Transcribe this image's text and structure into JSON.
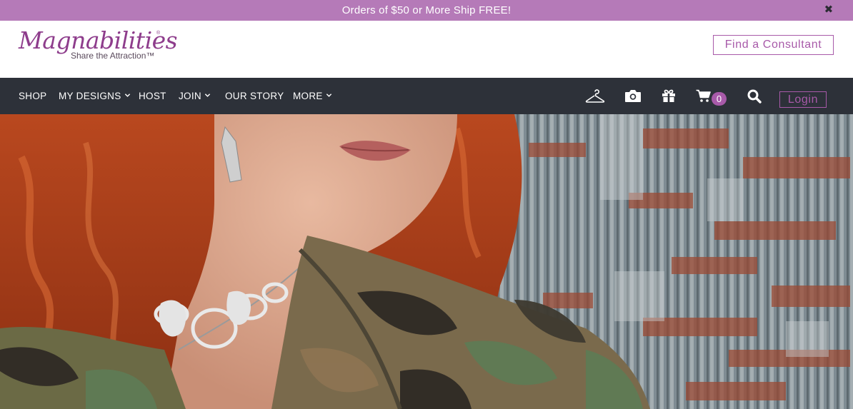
{
  "promo": {
    "text": "Orders of $50 or More Ship FREE!",
    "close_icon": "close-icon"
  },
  "header": {
    "logo_text": "Magnabilities",
    "logo_registered": "®",
    "logo_tagline": "Share the Attraction™",
    "consultant_button": "Find a Consultant"
  },
  "nav": {
    "items": [
      {
        "label": "SHOP",
        "dropdown": false
      },
      {
        "label": "MY DESIGNS",
        "dropdown": true
      },
      {
        "label": "HOST",
        "dropdown": false
      },
      {
        "label": "JOIN",
        "dropdown": true
      },
      {
        "label": "OUR STORY",
        "dropdown": false
      },
      {
        "label": "MORE",
        "dropdown": true
      }
    ],
    "icons": [
      "hanger-icon",
      "camera-icon",
      "gift-icon",
      "cart-icon",
      "search-icon"
    ],
    "cart_count": "0",
    "login_label": "Login"
  },
  "colors": {
    "promo_bg": "#b57ab8",
    "brand_purple": "#a85aa9",
    "nav_bg": "#2d3139"
  }
}
